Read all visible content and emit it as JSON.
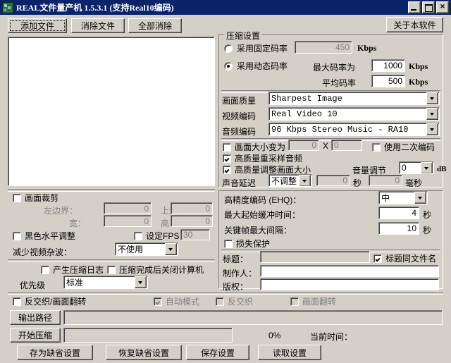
{
  "window": {
    "title": "REAL文件量产机  1.5.3.1  (支持Real10编码)",
    "minimize": "",
    "maximize": "",
    "close": "✕"
  },
  "toolbar": {
    "add_file": "添加文件",
    "remove_file": "消除文件",
    "remove_all": "全部消除",
    "about": "关于本软件"
  },
  "filelist": {
    "items": []
  },
  "crop": {
    "enable_label": "画面裁剪",
    "enable_checked": false,
    "left_label": "左边界：",
    "left_value": "0",
    "top_label": "上边界：",
    "top_value": "0",
    "width_label": "宽：",
    "width_value": "0",
    "height_label": "高：",
    "height_value": "0",
    "black_level_label": "黑色水平调整",
    "black_level_checked": false,
    "set_fps_label": "设定FPS",
    "set_fps_checked": false,
    "fps_value": "30",
    "noise_label": "减少视频杂波：",
    "noise_value": "不使用"
  },
  "logging": {
    "make_log_label": "产生压缩日志",
    "make_log_checked": false,
    "shutdown_label": "压缩完成后关闭计算机",
    "shutdown_checked": false,
    "priority_label": "优先级",
    "priority_value": "标准"
  },
  "deinterlace": {
    "main_label": "反交织/画面翻转",
    "main_checked": false,
    "auto_label": "自动模式",
    "auto_checked": true,
    "deint_label": "反交织",
    "deint_checked": false,
    "flip_label": "画面翻转",
    "flip_checked": false
  },
  "compression": {
    "group_label": "压缩设置",
    "cbr_label": "采用固定码率",
    "cbr_selected": false,
    "cbr_value": "450",
    "cbr_unit": "Kbps",
    "vbr_label": "采用动态码率",
    "vbr_selected": true,
    "max_rate_label": "最大码率为",
    "max_rate_value": "1000",
    "max_rate_unit": "Kbps",
    "avg_rate_label": "平均码率",
    "avg_rate_value": "500",
    "avg_rate_unit": "Kbps"
  },
  "codecs": {
    "quality_label": "画面质量",
    "quality_value": "Sharpest Image",
    "video_label": "视频编码",
    "video_value": "Real Video 10",
    "audio_label": "音频编码",
    "audio_value": "96 Kbps Stereo Music - RA10"
  },
  "resize": {
    "resize_label": "画面大小变为",
    "resize_checked": false,
    "width_value": "0",
    "x_label": "X",
    "height_value": "0",
    "two_pass_label": "使用二次编码",
    "two_pass_checked": false,
    "hq_resample_label": "高质量重采样音频",
    "hq_resample_checked": true,
    "hq_resize_label": "高质量调整画面大小",
    "hq_resize_checked": true,
    "volume_label": "音量调节",
    "volume_value": "0",
    "volume_unit": "dB",
    "delay_label": "声音延迟",
    "delay_mode": "不调整",
    "delay_sec_value": "0",
    "delay_sec_unit": "秒",
    "delay_ms_value": "0",
    "delay_ms_unit": "毫秒"
  },
  "advanced": {
    "ehq_label": "高精度编码 (EHQ)：",
    "ehq_value": "中",
    "buffer_label": "最大起始缓冲时间：",
    "buffer_value": "4",
    "buffer_unit": "秒",
    "keyframe_label": "关键帧最大间隔：",
    "keyframe_value": "10",
    "keyframe_unit": "秒",
    "loss_protect_label": "损失保护",
    "loss_protect_checked": false
  },
  "meta": {
    "title_label": "标题：",
    "title_value": "",
    "same_as_file_label": "标题同文件名",
    "same_as_file_checked": true,
    "author_label": "制作人：",
    "author_value": "",
    "copyright_label": "版权：",
    "copyright_value": ""
  },
  "bottom": {
    "output_path_button": "输出路径",
    "output_path_value": "",
    "start_button": "开始压缩",
    "progress_percent": "0%",
    "current_time_label": "当前时间：",
    "current_time_value": "",
    "save_default": "存为缺省设置",
    "restore_default": "恢复缺省设置",
    "save_settings": "保存设置",
    "load_settings": "读取设置"
  }
}
